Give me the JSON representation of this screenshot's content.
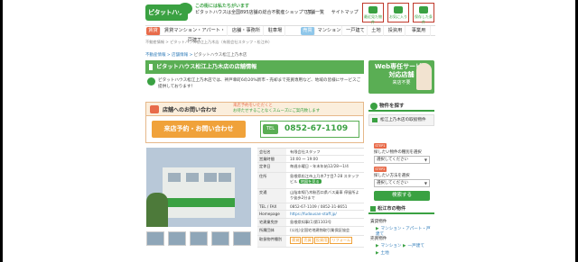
{
  "header": {
    "logo_text": "ピタットハウス",
    "tagline_1": "この街には私たちがいます",
    "tagline_2": "ピタットハウスは全国895店舗の総合不動産ショップです。",
    "links": [
      "店舗一覧",
      "サイトマップ"
    ],
    "buttons": [
      "最近見た物件",
      "お気に入り",
      "保存した条件"
    ]
  },
  "nav": {
    "items": [
      "賃貸",
      "賃貸マンション・アパート・戸建て",
      "店舗・事務所",
      "駐車場",
      "売買",
      "マンション",
      "一戸建て",
      "土地",
      "投資用",
      "事業用"
    ]
  },
  "breadcrumb_top": "不動産情報 > ピタットハウス松江上乃木店（有限会社スタッフ・松江市）",
  "breadcrumb": {
    "items": [
      "不動産情報",
      "店舗情報"
    ],
    "current": "ピタットハウス松江上乃木店"
  },
  "page_title": "ピタットハウス松江上乃木店の店舗情報",
  "intro": "ピタットハウス松江上乃木店では、神戸幸町6の20%新市・売却まで売買専用など、地域の皆様にサービスご提供しております！",
  "ad": {
    "line1": "Web専任サービス",
    "line2": "対応店舗",
    "line3": "来店不要"
  },
  "contact": {
    "title": "店舗へのお問い合わせ",
    "note_1": "来店予約をいただくと",
    "note_2": "お待たせすることなくスムーズにご案内致します",
    "reserve_label": "来店予約・お問い合わせ",
    "tel_tag": "TEL",
    "tel_number": "0852-67-1109"
  },
  "shop_info": {
    "rows": [
      {
        "k": "会社名",
        "v": "有限会社スタッフ"
      },
      {
        "k": "営業時間",
        "v": "10:00 〜 19:00"
      },
      {
        "k": "定休日",
        "v": "毎週水曜日・年末年始12/28〜1/4"
      },
      {
        "k": "住所",
        "v": "島根県松江市上乃木7丁目7-28 スタッフビル",
        "map": "地図を見る"
      },
      {
        "k": "交通",
        "v": "山陰本線乃木駅西口県バス乗車 停留所より徒歩2分まで"
      },
      {
        "k": "TEL / FAX",
        "v": "0852-67-1109 / 0852-31-8651"
      },
      {
        "k": "Homepage",
        "v": "https://fudousan-staff.jp/"
      },
      {
        "k": "宅建業免許",
        "v": "島根県知事(1)第1103号"
      },
      {
        "k": "所属団体",
        "v": "(公社)全国宅地建物取引業保証協会"
      },
      {
        "k": "取扱物件種別",
        "v": "",
        "tags": [
          "賃貸",
          "売買",
          "投資用",
          "リフォーム"
        ]
      }
    ]
  },
  "sidebar": {
    "title": "物件を探す",
    "shop_name": "松江上乃木店の取扱物件",
    "step1_tag": "STEP1",
    "step1": "探したい物件の種別を選択",
    "step1_value": "選択してください",
    "step2_tag": "STEP2",
    "step2": "探したい方法を選択",
    "step2_value": "選択してください",
    "search_label": "検索する",
    "section_title": "松江市の物件",
    "cat_rent": "賃貸物件",
    "rent_link": "マンション・アパート・戸建て",
    "cat_sale": "売買物件",
    "sale_links": [
      "マンション",
      "一戸建て",
      "土地"
    ]
  }
}
